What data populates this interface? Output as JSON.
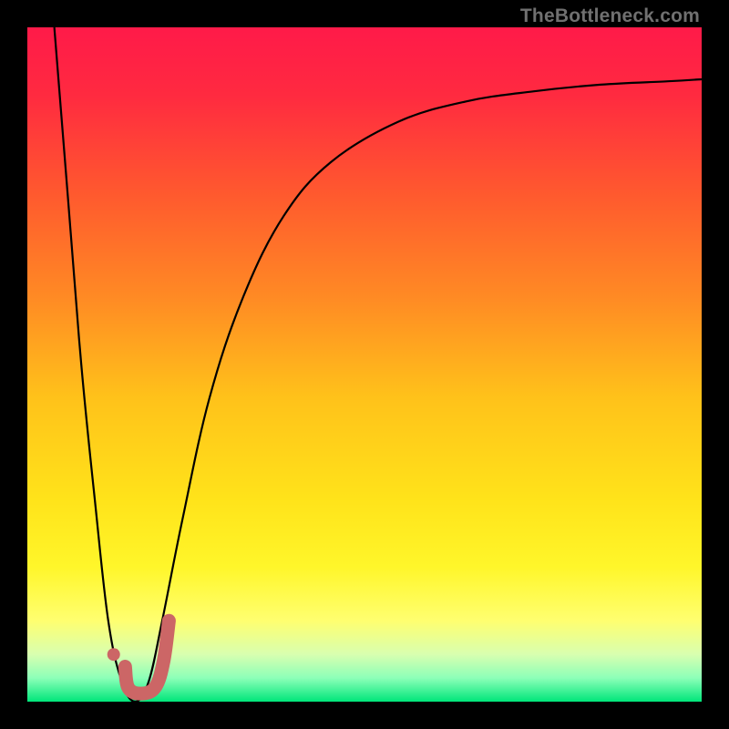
{
  "watermark": "TheBottleneck.com",
  "chart_data": {
    "type": "line",
    "title": "",
    "xlabel": "",
    "ylabel": "",
    "xlim": [
      0,
      100
    ],
    "ylim": [
      0,
      100
    ],
    "grid": false,
    "legend": false,
    "gradient_stops": [
      {
        "offset": 0.0,
        "color": "#ff1a49"
      },
      {
        "offset": 0.1,
        "color": "#ff2a40"
      },
      {
        "offset": 0.25,
        "color": "#ff5a2e"
      },
      {
        "offset": 0.4,
        "color": "#ff8a24"
      },
      {
        "offset": 0.55,
        "color": "#ffc21a"
      },
      {
        "offset": 0.7,
        "color": "#ffe31a"
      },
      {
        "offset": 0.8,
        "color": "#fff62a"
      },
      {
        "offset": 0.88,
        "color": "#ffff70"
      },
      {
        "offset": 0.93,
        "color": "#d8ffb0"
      },
      {
        "offset": 0.965,
        "color": "#8cffb8"
      },
      {
        "offset": 1.0,
        "color": "#00e67a"
      }
    ],
    "series": [
      {
        "name": "bottleneck-curve",
        "stroke": "#000000",
        "stroke_width": 2.2,
        "points": [
          {
            "x": 4,
            "y": 100
          },
          {
            "x": 6,
            "y": 75
          },
          {
            "x": 8,
            "y": 50
          },
          {
            "x": 10,
            "y": 30
          },
          {
            "x": 12,
            "y": 12
          },
          {
            "x": 14,
            "y": 3
          },
          {
            "x": 16,
            "y": 0
          },
          {
            "x": 18,
            "y": 3
          },
          {
            "x": 20,
            "y": 12
          },
          {
            "x": 23,
            "y": 27
          },
          {
            "x": 27,
            "y": 45
          },
          {
            "x": 32,
            "y": 60
          },
          {
            "x": 38,
            "y": 72
          },
          {
            "x": 45,
            "y": 80
          },
          {
            "x": 55,
            "y": 86
          },
          {
            "x": 65,
            "y": 89
          },
          {
            "x": 75,
            "y": 90.5
          },
          {
            "x": 85,
            "y": 91.5
          },
          {
            "x": 95,
            "y": 92
          },
          {
            "x": 100,
            "y": 92.3
          }
        ]
      },
      {
        "name": "marker-j-stroke",
        "stroke": "#cc6666",
        "stroke_width": 15,
        "linecap": "round",
        "points": [
          {
            "x": 14.5,
            "y": 5.2
          },
          {
            "x": 15.0,
            "y": 2.0
          },
          {
            "x": 17.0,
            "y": 1.2
          },
          {
            "x": 19.0,
            "y": 2.2
          },
          {
            "x": 20.2,
            "y": 6.0
          },
          {
            "x": 21.0,
            "y": 12.0
          }
        ]
      }
    ],
    "marker_dot": {
      "x": 12.8,
      "y": 7.0,
      "r": 7,
      "fill": "#cc6666"
    }
  }
}
